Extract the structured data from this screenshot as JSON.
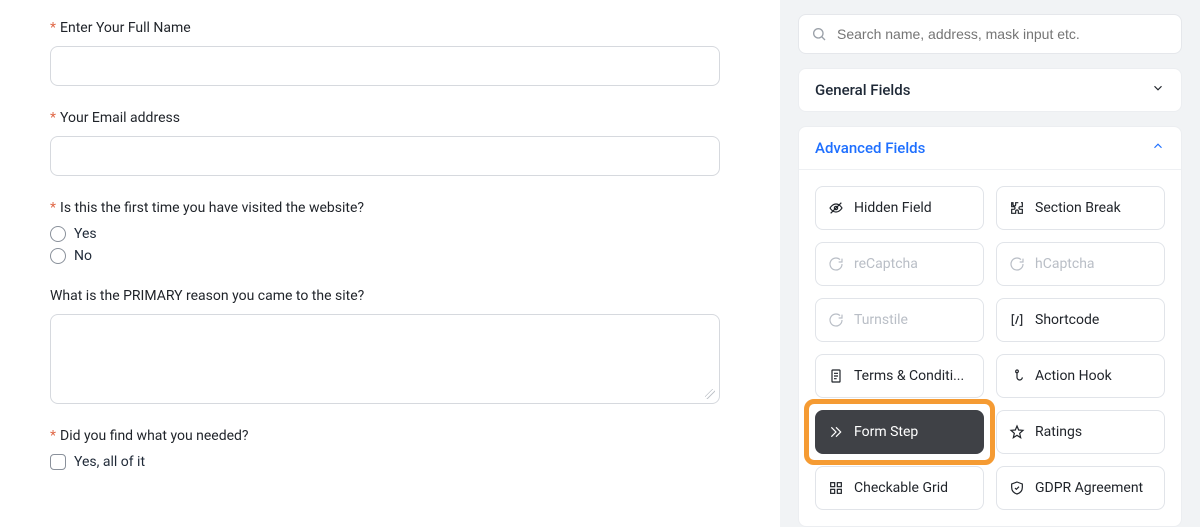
{
  "form": {
    "fields": [
      {
        "label": "Enter Your Full Name",
        "required": true,
        "type": "text"
      },
      {
        "label": "Your Email address",
        "required": true,
        "type": "text"
      },
      {
        "label": "Is this the first time you have visited the website?",
        "required": true,
        "type": "radio",
        "options": [
          "Yes",
          "No"
        ]
      },
      {
        "label": "What is the PRIMARY reason you came to the site?",
        "required": false,
        "type": "textarea"
      },
      {
        "label": "Did you find what you needed?",
        "required": true,
        "type": "checkbox",
        "options": [
          "Yes, all of it"
        ]
      }
    ]
  },
  "sidebar": {
    "search_placeholder": "Search name, address, mask input etc.",
    "sections": {
      "general": "General Fields",
      "advanced": "Advanced Fields"
    },
    "advanced_items": [
      {
        "icon": "eye-off",
        "label": "Hidden Field",
        "state": "normal"
      },
      {
        "icon": "puzzle",
        "label": "Section Break",
        "state": "normal"
      },
      {
        "icon": "captcha",
        "label": "reCaptcha",
        "state": "disabled"
      },
      {
        "icon": "captcha",
        "label": "hCaptcha",
        "state": "disabled"
      },
      {
        "icon": "captcha",
        "label": "Turnstile",
        "state": "disabled"
      },
      {
        "icon": "code",
        "label": "Shortcode",
        "state": "normal"
      },
      {
        "icon": "doc",
        "label": "Terms & Conditi...",
        "state": "normal"
      },
      {
        "icon": "hook",
        "label": "Action Hook",
        "state": "normal"
      },
      {
        "icon": "step",
        "label": "Form Step",
        "state": "highlight"
      },
      {
        "icon": "star",
        "label": "Ratings",
        "state": "normal"
      },
      {
        "icon": "grid",
        "label": "Checkable Grid",
        "state": "normal"
      },
      {
        "icon": "shield",
        "label": "GDPR Agreement",
        "state": "normal"
      }
    ]
  }
}
